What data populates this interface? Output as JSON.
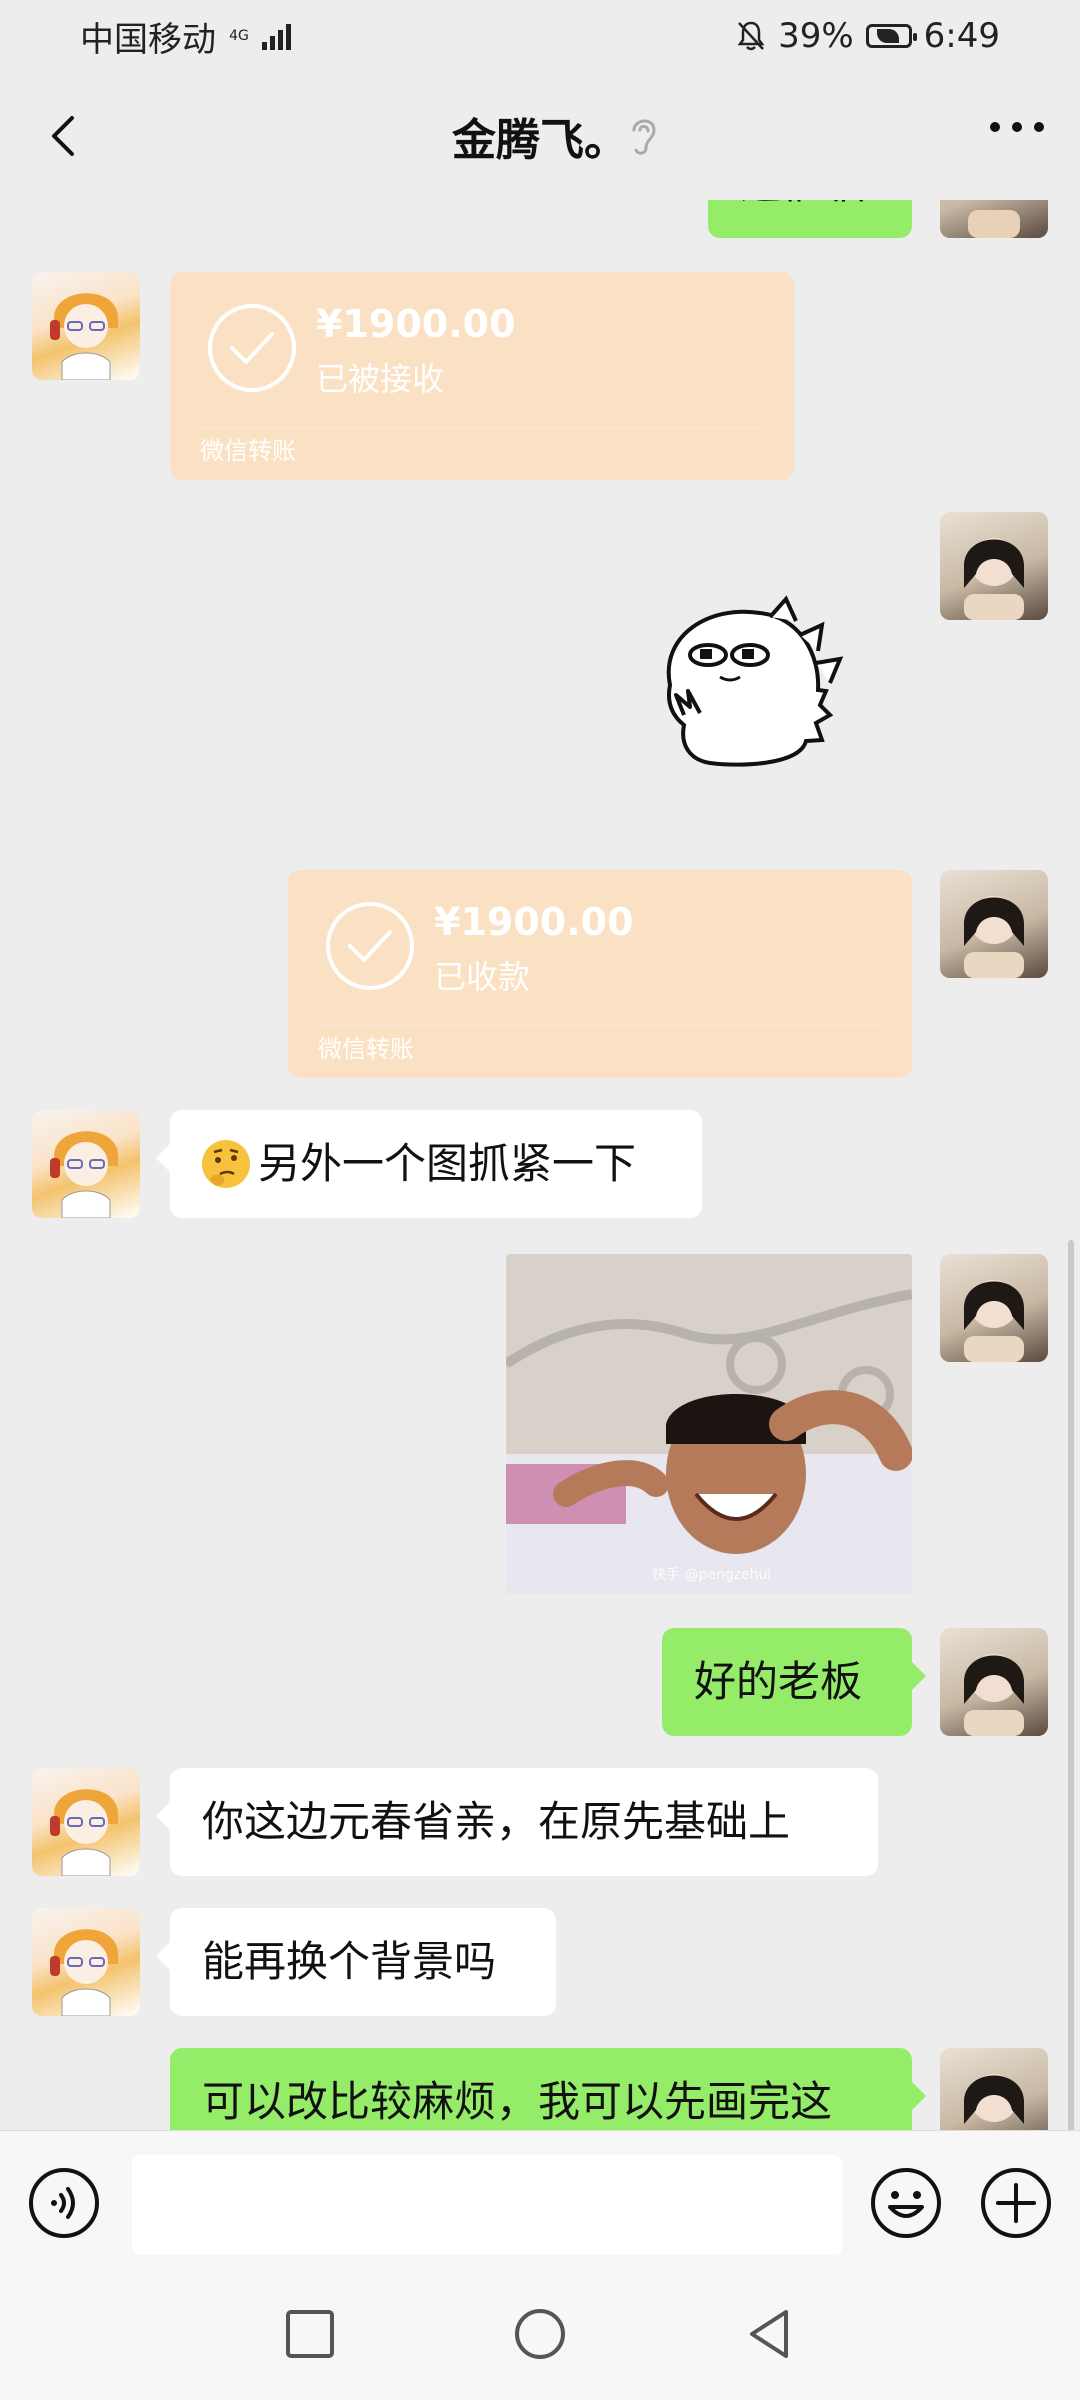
{
  "status_bar": {
    "carrier": "中国移动",
    "network": "4G",
    "battery_percent": "39%",
    "time": "6:49"
  },
  "header": {
    "title": "金腾飞。",
    "back_icon": "chevron-left-icon",
    "ear_icon": "ear-icon",
    "more_icon": "more-dots-icon"
  },
  "messages": [
    {
      "type": "text",
      "from": "me",
      "text": "这催临",
      "partial": true
    },
    {
      "type": "transfer",
      "from": "friend",
      "amount": "¥1900.00",
      "status": "已被接收",
      "label": "微信转账"
    },
    {
      "type": "sticker",
      "from": "me",
      "sticker": "dinosaur-sticker"
    },
    {
      "type": "transfer",
      "from": "me",
      "amount": "¥1900.00",
      "status": "已收款",
      "label": "微信转账"
    },
    {
      "type": "text",
      "from": "friend",
      "text": "另外一个图抓紧一下",
      "emoji": "thinking-face"
    },
    {
      "type": "image",
      "from": "me",
      "watermark": "快手 @pengzehui"
    },
    {
      "type": "text",
      "from": "me",
      "text": "好的老板"
    },
    {
      "type": "text",
      "from": "friend",
      "text": "你这边元春省亲，在原先基础上"
    },
    {
      "type": "text",
      "from": "friend",
      "text": "能再换个背景吗"
    },
    {
      "type": "text",
      "from": "me",
      "text": "可以改比较麻烦，我可以先画完这"
    }
  ],
  "input_bar": {
    "voice_icon": "voice-icon",
    "emoji_icon": "emoji-icon",
    "plus_icon": "plus-icon",
    "text": ""
  },
  "nav_bar": {
    "recents_icon": "square-icon",
    "home_icon": "circle-icon",
    "back_icon": "triangle-back-icon"
  },
  "colors": {
    "background": "#ededed",
    "green_bubble": "#95ec69",
    "white_bubble": "#ffffff",
    "transfer": "#fbe1c3"
  }
}
